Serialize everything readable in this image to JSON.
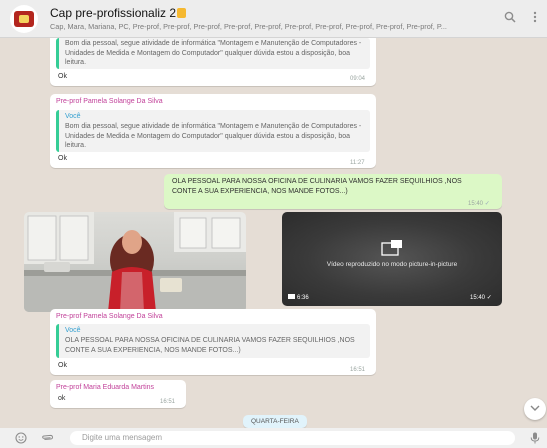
{
  "header": {
    "title": "Cap pre-profissionaliz 2",
    "subtitle": "Cap, Mara, Mariana, PC, Pre-prof, Pre-prof, Pre-prof, Pre-prof, Pre-prof, Pre-prof, Pre-prof, Pre-prof, Pre-prof, Pre-prof, P..."
  },
  "messages": {
    "m1": {
      "quote_text": "Bom dia pessoal, segue atividade de informática \"Montagem e Manutenção de Computadores - Unidades de Medida e Montagem do Computador\" qualquer dúvida estou a disposição, boa leitura.",
      "text": "Ok",
      "time": "09:04"
    },
    "m2": {
      "sender": "Pre-prof Pamela Solange Da Silva",
      "quote_name": "Você",
      "quote_text": "Bom dia pessoal, segue atividade de informática \"Montagem e Manutenção de Computadores - Unidades de Medida e Montagem do Computador\" qualquer dúvida estou a disposição, boa leitura.",
      "text": "Ok",
      "time": "11:27"
    },
    "m3": {
      "text": "OLA PESSOAL PARA NOSSA OFICINA DE CULINARIA VAMOS FAZER SEQUILHIOS ,NOS CONTE A SUA EXPERIENCIA, NOS MANDE FOTOS...)",
      "time": "15:40"
    },
    "video": {
      "pip_label": "Vídeo reproduzido no modo picture-in-picture",
      "duration": "6:36",
      "time": "15:40"
    },
    "m4": {
      "sender": "Pre-prof Pamela Solange Da Silva",
      "quote_name": "Você",
      "quote_text": "OLA PESSOAL PARA NOSSA OFICINA DE CULINARIA VAMOS FAZER SEQUILHIOS ,NOS CONTE A SUA EXPERIENCIA, NOS MANDE FOTOS...)",
      "text": "Ok",
      "time": "16:51"
    },
    "m5": {
      "sender": "Pre-prof Maria Eduarda Martins",
      "text": "ok",
      "time": "16:51"
    }
  },
  "day_divider": "QUARTA-FEIRA",
  "composer": {
    "placeholder": "Digite uma mensagem"
  },
  "colors": {
    "sender_name": "#c2429a",
    "quote_accent": "#35cd96",
    "outgoing_bubble": "#dcf8c6",
    "chat_background": "#e5ddd5"
  },
  "icons": [
    "search-icon",
    "menu-dots-icon",
    "emoji-icon",
    "attach-icon",
    "mic-icon",
    "chevron-down-icon",
    "read-check-icon",
    "video-camera-icon",
    "pip-icon"
  ]
}
